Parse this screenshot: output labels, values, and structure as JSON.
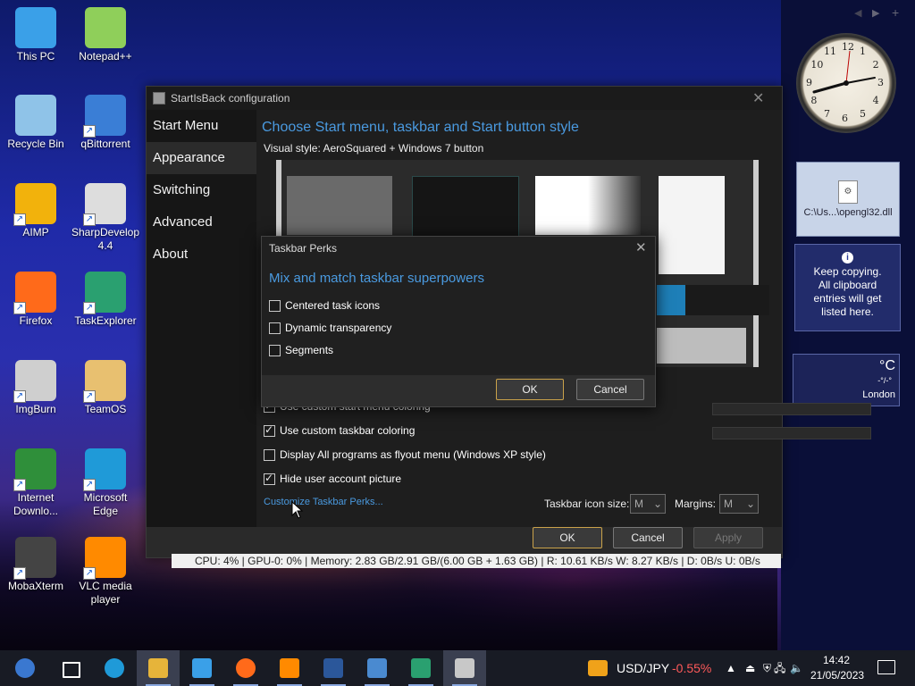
{
  "desktop_icons": [
    {
      "label": "This PC",
      "icon": "computer-icon",
      "color": "#3aa0e8"
    },
    {
      "label": "Notepad++",
      "icon": "notepad-plus-plus-icon",
      "color": "#8fcf5a"
    },
    {
      "label": "Recycle Bin",
      "icon": "recycle-bin-icon",
      "color": "#8fc3e8"
    },
    {
      "label": "qBittorrent",
      "icon": "qbittorrent-icon",
      "color": "#3a7ed6"
    },
    {
      "label": "AIMP",
      "icon": "aimp-icon",
      "color": "#f2b20c"
    },
    {
      "label": "SharpDevelop 4.4",
      "icon": "sharpdevelop-icon",
      "color": "#ddd"
    },
    {
      "label": "Firefox",
      "icon": "firefox-icon",
      "color": "#ff6a1a"
    },
    {
      "label": "TaskExplorer",
      "icon": "taskexplorer-icon",
      "color": "#2aa070"
    },
    {
      "label": "ImgBurn",
      "icon": "imgburn-icon",
      "color": "#cfcfcf"
    },
    {
      "label": "TeamOS",
      "icon": "teamos-icon",
      "color": "#e8c070"
    },
    {
      "label": "Internet Downlo...",
      "icon": "internet-download-manager-icon",
      "color": "#2f8f3a"
    },
    {
      "label": "Microsoft Edge",
      "icon": "edge-icon",
      "color": "#1f9ad8"
    },
    {
      "label": "MobaXterm",
      "icon": "mobaxterm-icon",
      "color": "#444"
    },
    {
      "label": "VLC media player",
      "icon": "vlc-icon",
      "color": "#ff8a00"
    }
  ],
  "gadgets": {
    "clock_numbers": [
      "12",
      "1",
      "2",
      "3",
      "4",
      "5",
      "6",
      "7",
      "8",
      "9",
      "10",
      "11"
    ],
    "file_label": "C:\\Us...\\opengl32.dll",
    "clipboard_text": "Keep copying. All clipboard entries will get listed here.",
    "weather_unit": "°C",
    "weather_dash": "-°/-°",
    "weather_city": "London"
  },
  "window": {
    "title": "StartIsBack configuration",
    "nav": [
      "Start Menu",
      "Appearance",
      "Switching",
      "Advanced",
      "About"
    ],
    "active_nav": "Appearance",
    "heading": "Choose Start menu, taskbar and Start button style",
    "visual_style": "Visual style:  AeroSquared + Windows 7 button",
    "options": [
      {
        "label": "Use custom start menu coloring",
        "checked": true
      },
      {
        "label": "Use custom taskbar coloring",
        "checked": true
      },
      {
        "label": "Display All programs as flyout menu (Windows XP style)",
        "checked": false
      },
      {
        "label": "Hide user account picture",
        "checked": true
      }
    ],
    "perks_link": "Customize Taskbar Perks...",
    "icon_size_label": "Taskbar icon size:",
    "icon_size_value": "M",
    "margins_label": "Margins:",
    "margins_value": "M",
    "ok": "OK",
    "cancel": "Cancel",
    "apply": "Apply",
    "accent": "#4a9ae0"
  },
  "dialog": {
    "title": "Taskbar Perks",
    "heading": "Mix and match taskbar superpowers",
    "options": [
      {
        "label": "Centered task icons",
        "checked": false
      },
      {
        "label": "Dynamic transparency",
        "checked": false
      },
      {
        "label": "Segments",
        "checked": false
      }
    ],
    "ok": "OK",
    "cancel": "Cancel"
  },
  "status_strip": "CPU: 4%  | GPU-0: 0%  | Memory: 2.83 GB/2.91 GB/(6.00 GB + 1.63 GB)  | R: 10.61 KB/s W: 8.27 KB/s  | D: 0B/s U: 0B/s",
  "taskbar": {
    "apps": [
      "start-orb-icon",
      "task-view-icon",
      "edge-icon",
      "file-explorer-icon",
      "store-icon",
      "firefox-icon",
      "vlc-icon",
      "word-icon",
      "control-panel-icon",
      "taskexplorer-icon",
      "startisback-icon"
    ],
    "ticker_label": "USD/JPY",
    "ticker_value": "-0.55%",
    "ticker_color": "#ff5a5a",
    "time": "14:42",
    "date": "21/05/2023"
  }
}
